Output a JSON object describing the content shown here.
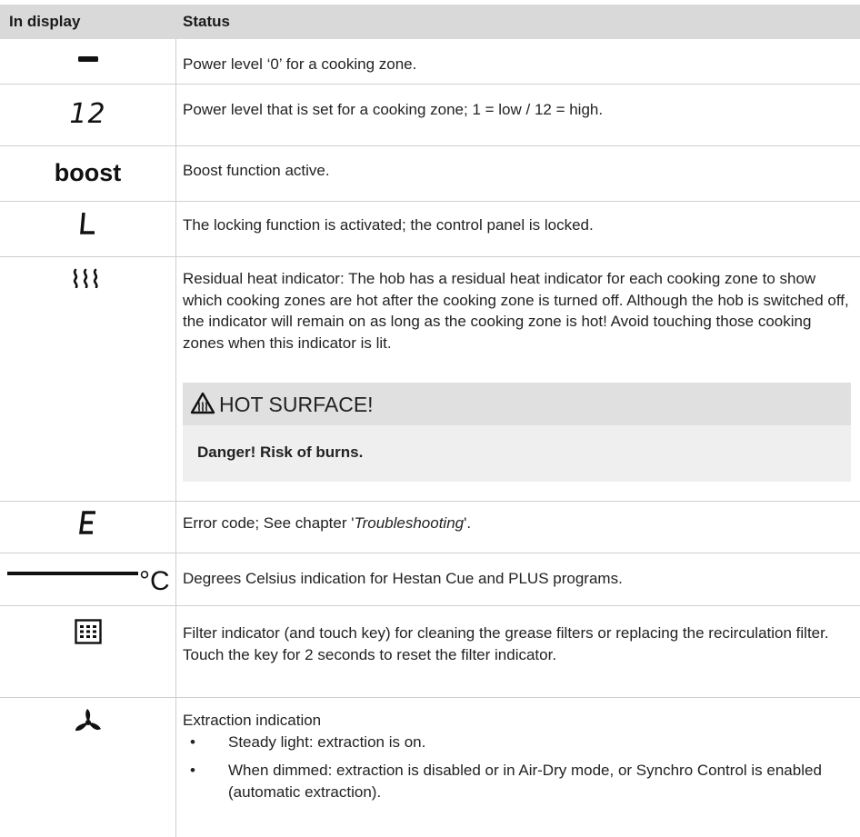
{
  "header": {
    "col1": "In display",
    "col2": "Status"
  },
  "rows": [
    {
      "icon": "dash-segment-icon",
      "text": "Power level ‘0’ for a cooking zone."
    },
    {
      "icon": "twelve-segment-icon",
      "glyph": "12",
      "text": "Power level that is set for a cooking zone; 1 = low / 12 = high."
    },
    {
      "icon": "boost-label",
      "glyph": "boost",
      "text": "Boost function active."
    },
    {
      "icon": "lock-segment-icon",
      "text": "The locking function is activated; the control panel is locked."
    },
    {
      "icon": "residual-heat-icon",
      "text": "Residual heat indicator: The hob has a residual heat indicator for each cooking zone to show which cooking zones are hot after the cooking zone is turned off. Although the hob is switched off, the indicator will remain on as long as the cooking zone is hot! Avoid touching those cooking zones when this indicator is lit.",
      "warning": {
        "title": "HOT SURFACE!",
        "text": "Danger! Risk of burns."
      }
    },
    {
      "icon": "error-segment-icon",
      "text_before": "Error code; See chapter '",
      "text_italic": "Troubleshooting",
      "text_after": "'."
    },
    {
      "icon": "celsius-bar-icon",
      "glyph": "°C",
      "text": "Degrees Celsius indication for Hestan Cue and PLUS programs."
    },
    {
      "icon": "filter-grid-icon",
      "text": "Filter indicator (and touch key) for cleaning the grease filters or replacing the recirculation filter.",
      "text2": "Touch the key for 2 seconds to reset the filter indicator."
    },
    {
      "icon": "fan-icon",
      "text": "Extraction indication",
      "bullets": [
        "Steady light: extraction is on.",
        "When dimmed: extraction is disabled or in Air-Dry mode, or Synchro Control is enabled (automatic extraction)."
      ],
      "bullet_glyph": "•"
    }
  ]
}
